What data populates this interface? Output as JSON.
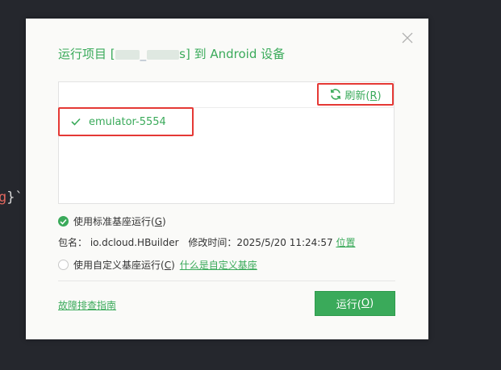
{
  "background": {
    "code_red": "g",
    "code_rest": "}`"
  },
  "dialog": {
    "title_prefix": "运行项目 [",
    "title_sep": "_",
    "title_tail": "s",
    "title_suffix": "] 到 Android 设备",
    "refresh_label": "刷新(",
    "refresh_key": "R",
    "refresh_close": ")",
    "devices": [
      {
        "name": "emulator-5554",
        "selected": true
      }
    ],
    "standard_base": {
      "label": "使用标准基座运行(",
      "key": "G",
      "close": ")",
      "checked": true
    },
    "package_label": "包名：",
    "package_value": "io.dcloud.HBuilder",
    "modified_label": "修改时间：",
    "modified_value": "2025/5/20 11:24:57",
    "location_link": "位置",
    "custom_base": {
      "label": "使用自定义基座运行(",
      "key": "C",
      "close": ")",
      "checked": false
    },
    "custom_base_help_link": "什么是自定义基座",
    "troubleshoot_link": "故障排查指南",
    "run_label": "运行(",
    "run_key": "O",
    "run_close": ")"
  },
  "colors": {
    "accent": "#3aaa5a",
    "highlight": "#e53935",
    "dialog_bg": "#fafaf8",
    "editor_bg": "#25272d"
  }
}
